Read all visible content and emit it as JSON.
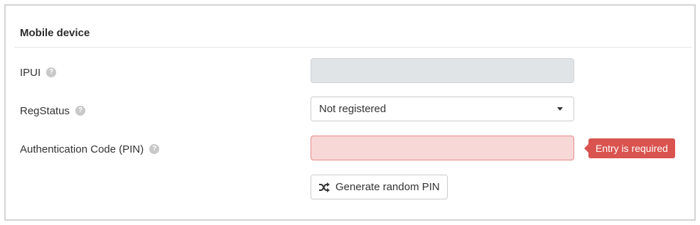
{
  "section": {
    "title": "Mobile device"
  },
  "fields": {
    "ipui": {
      "label": "IPUI",
      "value": "",
      "help_icon": "question-circle-icon"
    },
    "regstatus": {
      "label": "RegStatus",
      "selected": "Not registered",
      "help_icon": "question-circle-icon"
    },
    "pin": {
      "label": "Authentication Code (PIN)",
      "value": "",
      "help_icon": "question-circle-icon",
      "error": "Entry is required"
    }
  },
  "actions": {
    "generate_pin_label": "Generate random PIN",
    "generate_pin_icon": "shuffle-icon"
  },
  "colors": {
    "error_background": "#f8d7d7",
    "error_border": "#e48a8a",
    "error_badge": "#d9534f",
    "disabled_field": "#e1e4e7"
  }
}
